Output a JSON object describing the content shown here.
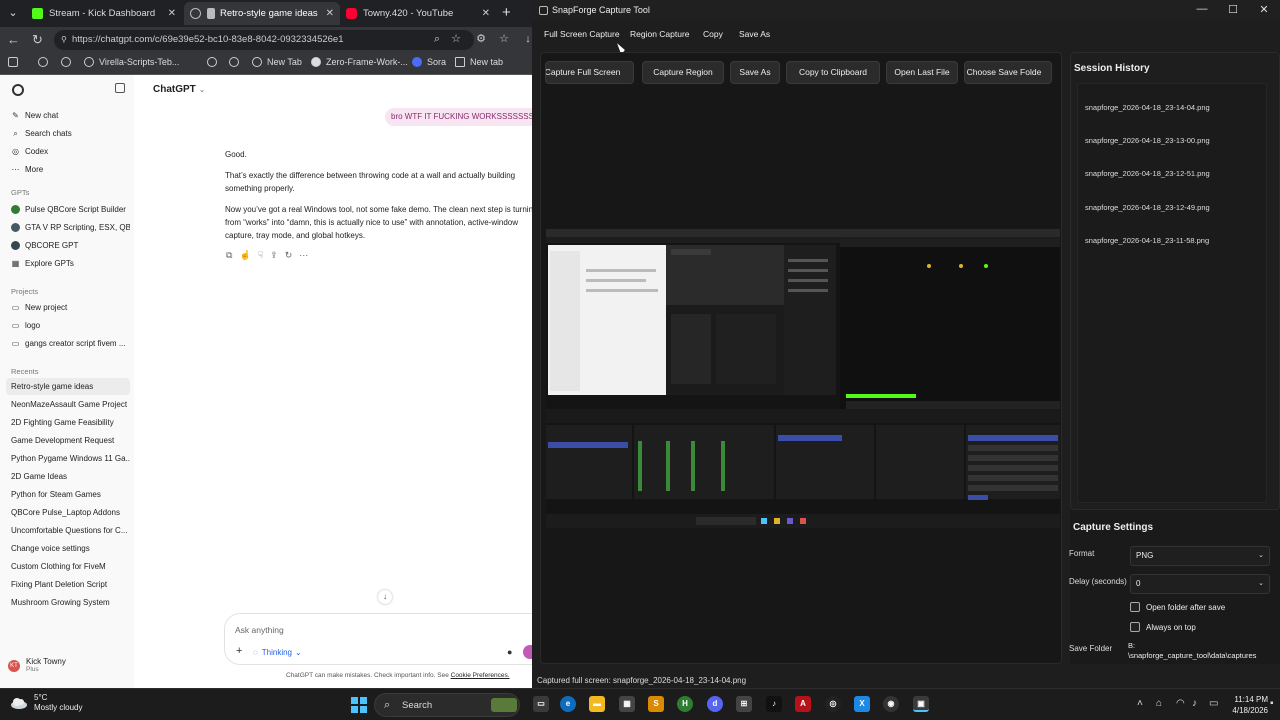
{
  "browser": {
    "tabs": [
      {
        "label": "Stream - Kick Dashboard",
        "color": "#53fc18"
      },
      {
        "label": "Retro-style game ideas",
        "color": "#bbbbbb"
      },
      {
        "label": "Towny.420 - YouTube",
        "color": "#ff0033"
      }
    ],
    "url": "https://chatgpt.com/c/69e39e52-bc10-83e8-8042-0932334526e1",
    "bookmarks": [
      "Virella-Scripts-Teb...",
      "New Tab",
      "Zero-Frame-Work-...",
      "Sora",
      "New tab"
    ]
  },
  "chatgpt": {
    "sidebar": {
      "top_items": [
        "New chat",
        "Search chats",
        "Codex",
        "More"
      ],
      "gpts_label": "GPTs",
      "gpts": [
        {
          "label": "Pulse QBCore Script Builder",
          "color": "#2e7d32"
        },
        {
          "label": "GTA V RP Scripting, ESX, QB...",
          "color": "#455a64"
        },
        {
          "label": "QBCORE GPT",
          "color": "#37474f"
        },
        {
          "label": "Explore GPTs",
          "color": ""
        }
      ],
      "projects_label": "Projects",
      "projects": [
        "New project",
        "logo",
        "gangs creator script fivem ..."
      ],
      "recents_label": "Recents",
      "recents": [
        "Retro-style game ideas",
        "NeonMazeAssault Game Project",
        "2D Fighting Game Feasibility",
        "Game Development Request",
        "Python Pygame Windows 11 Ga...",
        "2D Game Ideas",
        "Python for Steam Games",
        "QBCore Pulse_Laptop Addons",
        "Uncomfortable Questions for C...",
        "Change voice settings",
        "Custom Clothing for FiveM",
        "Fixing Plant Deletion Script",
        "Mushroom Growing System"
      ],
      "user": {
        "initials": "KT",
        "name": "Kick Towny",
        "plan": "Plus"
      }
    },
    "title": "ChatGPT",
    "user_message": "bro WTF IT FUCKING WORKSSSSSSSSSS",
    "reply": [
      "Good.",
      "That’s exactly the difference between throwing code at a wall and actually building something properly.",
      "Now you’ve got a real Windows tool, not some fake demo. The clean next step is turnin from “works” into “damn, this is actually nice to use” with annotation, active-window capture, tray mode, and global hotkeys."
    ],
    "composer": {
      "placeholder": "Ask anything",
      "mode": "Thinking"
    },
    "disclaimer": "ChatGPT can make mistakes. Check important info. See",
    "disclaimer_link": "Cookie Preferences."
  },
  "snapforge": {
    "title": "SnapForge Capture Tool",
    "menu": [
      "Full Screen Capture",
      "Region Capture",
      "Copy",
      "Save As"
    ],
    "buttons": [
      "Capture Full Screen",
      "Capture Region",
      "Save As",
      "Copy to Clipboard",
      "Open Last File",
      "Choose Save Folde"
    ],
    "history_title": "Session History",
    "history": [
      "snapforge_2026-04-18_23-14-04.png",
      "snapforge_2026-04-18_23-13-00.png",
      "snapforge_2026-04-18_23-12-51.png",
      "snapforge_2026-04-18_23-12-49.png",
      "snapforge_2026-04-18_23-11-58.png"
    ],
    "settings_title": "Capture Settings",
    "format_label": "Format",
    "format_value": "PNG",
    "delay_label": "Delay (seconds)",
    "delay_value": "0",
    "open_folder_label": "Open folder after save",
    "always_on_top_label": "Always on top",
    "save_folder_label": "Save Folder",
    "save_folder_value_1": "B:",
    "save_folder_value_2": "\\snapforge_capture_tool\\data\\captures",
    "status": "Captured full screen: snapforge_2026-04-18_23-14-04.png"
  },
  "taskbar": {
    "weather_temp": "5°C",
    "weather_desc": "Mostly cloudy",
    "search_label": "Search",
    "time": "11:14 PM",
    "date": "4/18/2026"
  }
}
